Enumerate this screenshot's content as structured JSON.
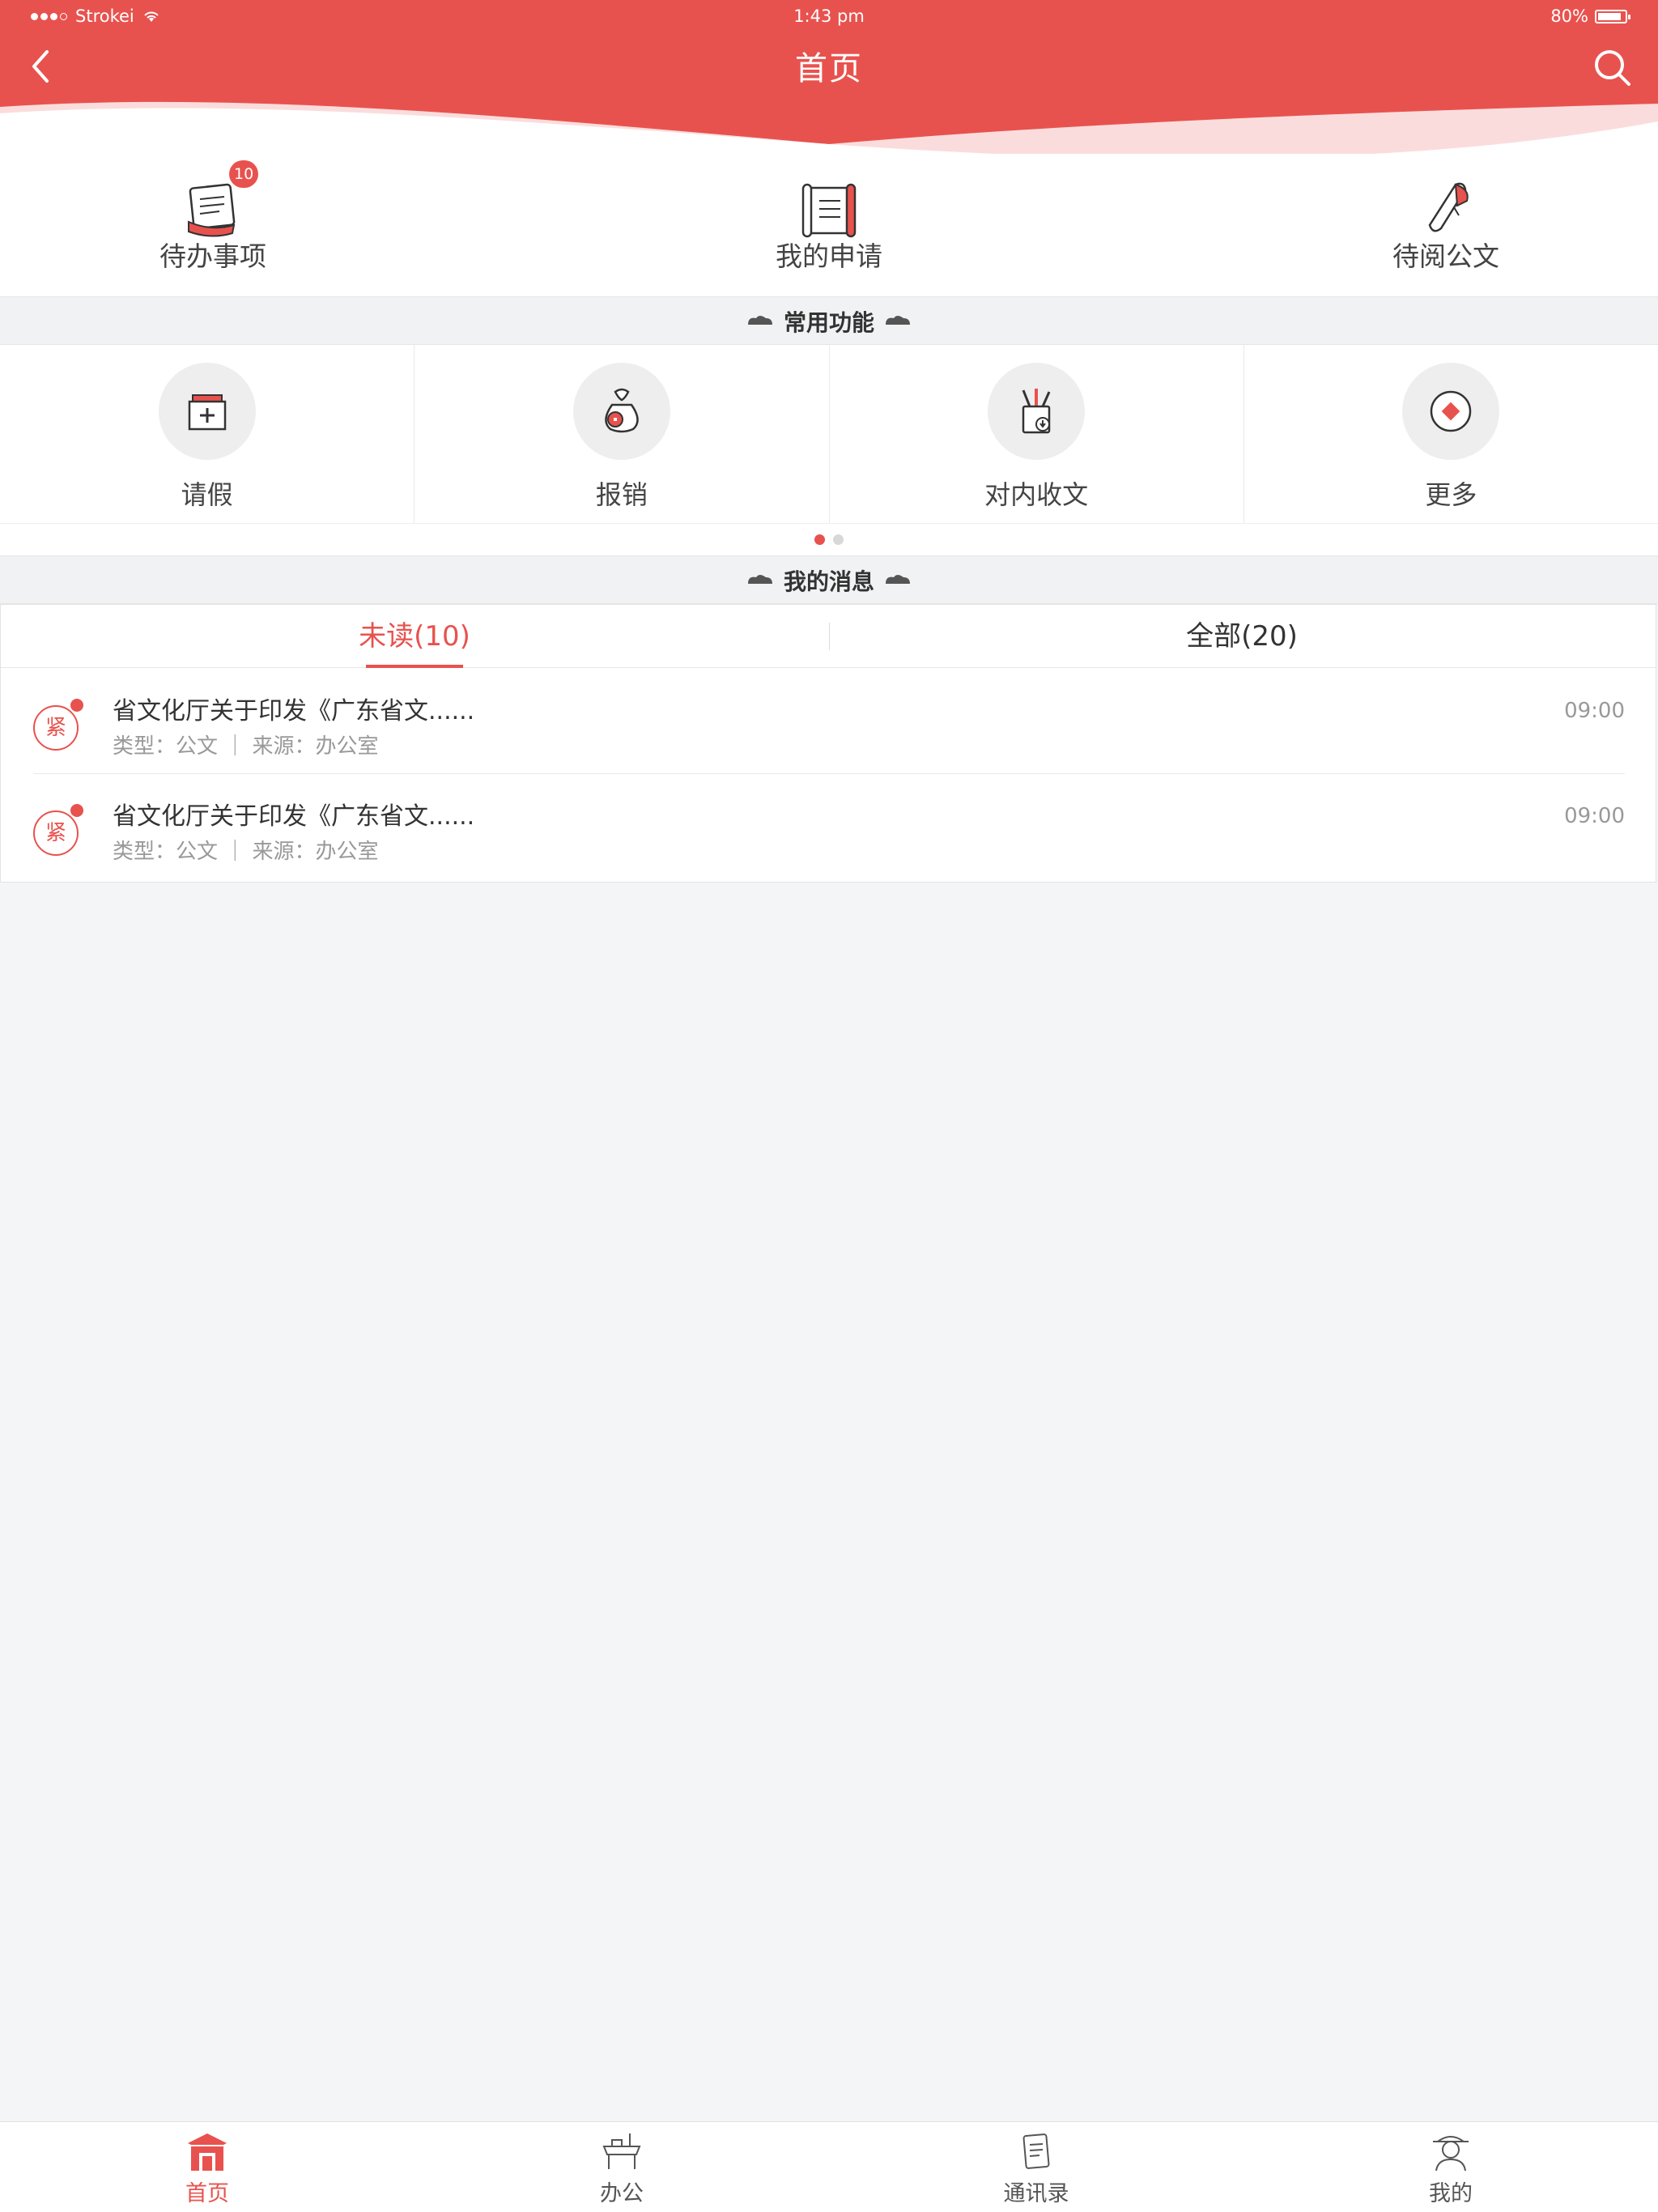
{
  "status_bar": {
    "carrier": "Strokei",
    "time": "1:43 pm",
    "battery": "80%"
  },
  "nav": {
    "title": "首页"
  },
  "quick": [
    {
      "label": "待办事项",
      "badge": "10"
    },
    {
      "label": "我的申请"
    },
    {
      "label": "待阅公文"
    }
  ],
  "sections": {
    "common": "常用功能",
    "messages": "我的消息"
  },
  "functions": [
    {
      "label": "请假"
    },
    {
      "label": "报销"
    },
    {
      "label": "对内收文"
    },
    {
      "label": "更多"
    }
  ],
  "pager": {
    "pages": 2,
    "current": 1
  },
  "message_tabs": {
    "unread": "未读(10)",
    "all": "全部(20)"
  },
  "messages": [
    {
      "tag": "紧",
      "title": "省文化厅关于印发《广东省文......",
      "meta": "类型：公文 ｜ 来源：办公室",
      "time": "09:00"
    },
    {
      "tag": "紧",
      "title": "省文化厅关于印发《广东省文......",
      "meta": "类型：公文 ｜ 来源：办公室",
      "time": "09:00"
    }
  ],
  "tabbar": [
    {
      "label": "首页"
    },
    {
      "label": "办公"
    },
    {
      "label": "通讯录"
    },
    {
      "label": "我的"
    }
  ],
  "colors": {
    "accent": "#e8524e",
    "background": "#f4f5f7"
  }
}
